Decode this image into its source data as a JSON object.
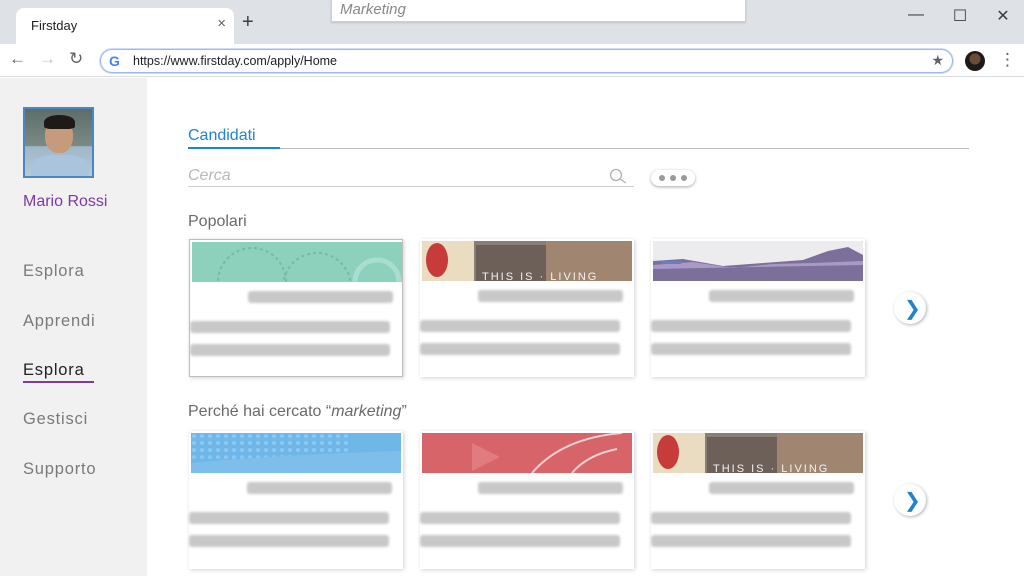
{
  "browser": {
    "tab_title": "Firstday",
    "tab_close": "×",
    "new_tab": "+",
    "overlay_search_text": "Marketing",
    "url": "https://www.firstday.com/apply/Home",
    "window_controls": {
      "minimize": "—",
      "maximize": "☐",
      "close": "✕"
    }
  },
  "sidebar": {
    "user_name": "Mario Rossi",
    "items": [
      {
        "label": "Esplora",
        "active": false
      },
      {
        "label": "Apprendi",
        "active": false
      },
      {
        "label": "Esplora",
        "active": true
      },
      {
        "label": "Gestisci",
        "active": false
      },
      {
        "label": "Supporto",
        "active": false
      }
    ]
  },
  "main": {
    "tab_label": "Candidati",
    "search_placeholder": "Cerca",
    "section_popular": "Popolari",
    "section_search_prefix": "Perché hai cercato “",
    "section_search_term": "marketing",
    "section_search_suffix": "”"
  },
  "colors": {
    "accent_blue": "#1d86c9",
    "accent_purple": "#7b3aa6"
  },
  "icons": [
    "back-icon",
    "forward-icon",
    "reload-icon",
    "google-icon",
    "star-icon",
    "kebab-menu-icon",
    "search-icon",
    "more-options-icon",
    "chevron-right-icon"
  ]
}
